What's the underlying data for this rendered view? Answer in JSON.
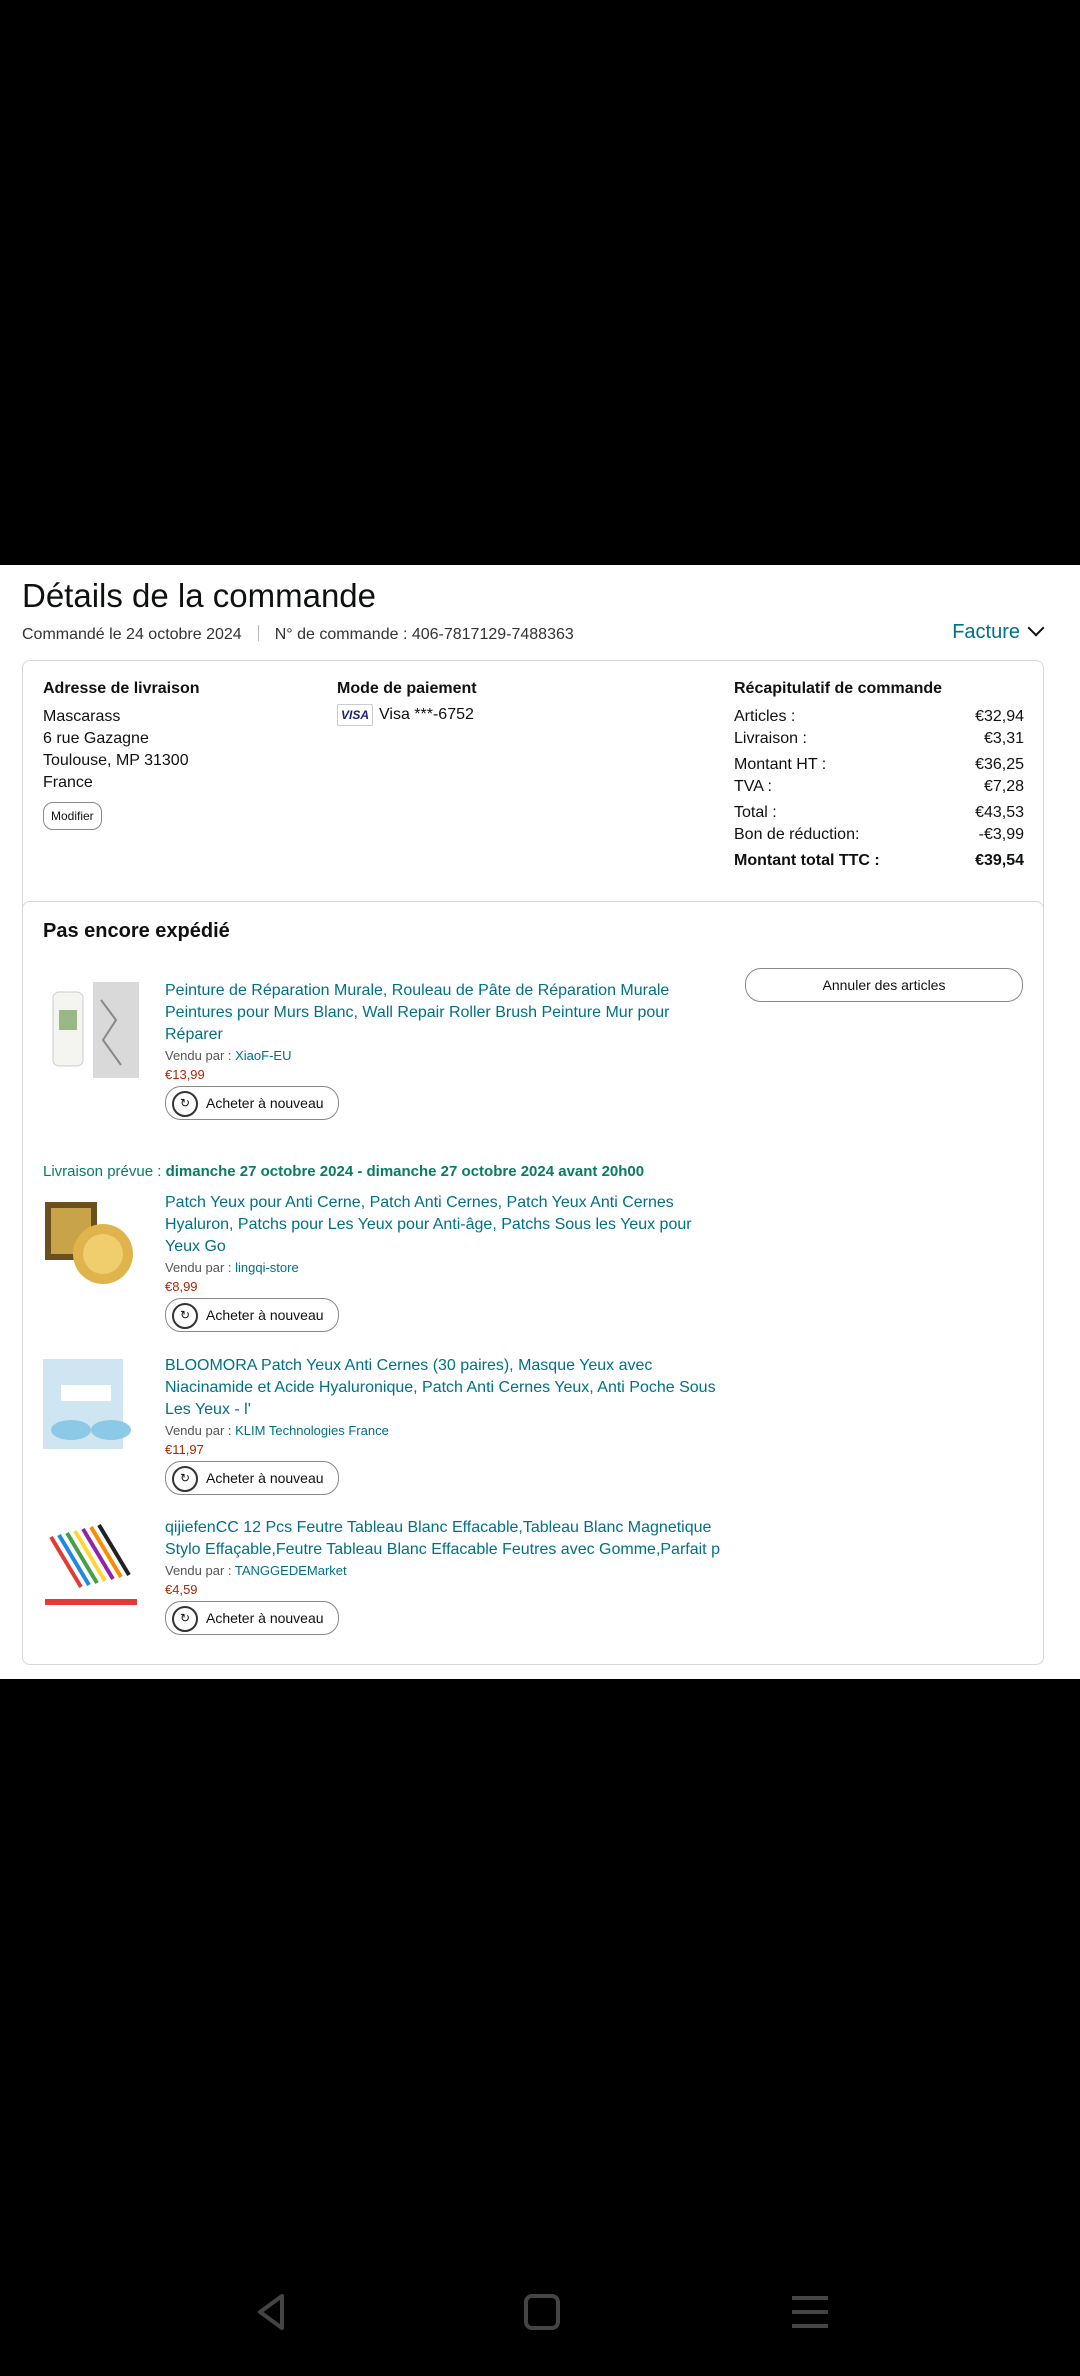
{
  "header": {
    "title": "Détails de la commande",
    "ordered_on": "Commandé le 24 octobre 2024",
    "order_number": "N° de commande : 406-7817129-7488363",
    "invoice_label": "Facture"
  },
  "address": {
    "heading": "Adresse de livraison",
    "lines": [
      "Mascarass",
      "6 rue Gazagne",
      "Toulouse, MP 31300",
      "France"
    ],
    "modify_label": "Modifier"
  },
  "payment": {
    "heading": "Mode de paiement",
    "card_brand": "VISA",
    "card_text": "Visa ***-6752"
  },
  "summary": {
    "heading": "Récapitulatif de commande",
    "rows": [
      {
        "label": "Articles :",
        "value": "€32,94"
      },
      {
        "label": "Livraison :",
        "value": "€3,31"
      },
      {
        "label": "Montant HT :",
        "value": "€36,25"
      },
      {
        "label": "TVA :",
        "value": "€7,28"
      },
      {
        "label": "Total :",
        "value": "€43,53"
      },
      {
        "label": "Bon de réduction:",
        "value": "-€3,99"
      }
    ],
    "grand_total_label": "Montant total TTC :",
    "grand_total_value": "€39,54"
  },
  "shipment": {
    "title": "Pas encore expédié",
    "cancel_label": "Annuler des articles",
    "delivery_prefix": "Livraison prévue :",
    "delivery_dates": "dimanche 27 octobre 2024 - dimanche 27 octobre 2024 avant 20h00",
    "buy_again_label": "Acheter à nouveau",
    "sold_by_label": "Vendu par :",
    "items": [
      {
        "title": "Peinture de Réparation Murale, Rouleau de Pâte de Réparation Murale Peintures pour Murs Blanc, Wall Repair Roller Brush Peinture Mur pour Réparer",
        "seller": "XiaoF-EU",
        "price": "€13,99"
      },
      {
        "title": "Patch Yeux pour Anti Cerne, Patch Anti Cernes, Patch Yeux Anti Cernes Hyaluron, Patchs pour Les Yeux pour Anti-âge, Patchs Sous les Yeux pour Yeux Go",
        "seller": "lingqi-store",
        "price": "€8,99"
      },
      {
        "title": "BLOOMORA Patch Yeux Anti Cernes (30 paires), Masque Yeux avec Niacinamide et Acide Hyaluronique, Patch Anti Cernes Yeux, Anti Poche Sous Les Yeux - l'",
        "seller": "KLIM Technologies France",
        "price": "€11,97"
      },
      {
        "title": "qijiefenCC 12 Pcs Feutre Tableau Blanc Effacable,Tableau Blanc Magnetique Stylo Effaçable,Feutre Tableau Blanc Effacable Feutres avec Gomme,Parfait p",
        "seller": "TANGGEDEMarket",
        "price": "€4,59"
      }
    ]
  }
}
